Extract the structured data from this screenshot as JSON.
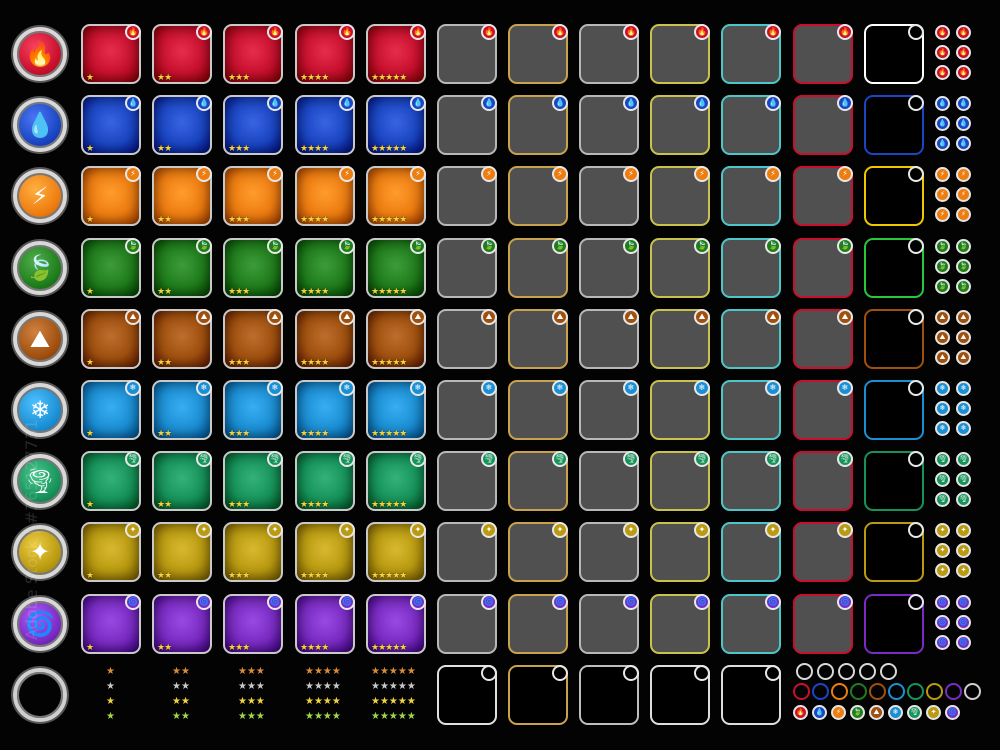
{
  "elements": [
    {
      "name": "fire",
      "icon": "fire-icon",
      "glyph": "🔥",
      "color": "#c8102e"
    },
    {
      "name": "water",
      "icon": "water-drop-icon",
      "glyph": "💧",
      "color": "#1a46c4"
    },
    {
      "name": "lightning",
      "icon": "lightning-icon",
      "glyph": "⚡",
      "color": "#ee7d10"
    },
    {
      "name": "nature",
      "icon": "leaf-icon",
      "glyph": "🍃",
      "color": "#1f7d1b"
    },
    {
      "name": "earth",
      "icon": "rock-icon",
      "glyph": "⛰",
      "color": "#a0500e"
    },
    {
      "name": "ice",
      "icon": "ice-crystal-icon",
      "glyph": "❄",
      "color": "#1b8fd4"
    },
    {
      "name": "wind",
      "icon": "tornado-icon",
      "glyph": "🌪",
      "color": "#16935a"
    },
    {
      "name": "light",
      "icon": "sparkle-icon",
      "glyph": "✦",
      "color": "#b99a10"
    },
    {
      "name": "dark",
      "icon": "vortex-icon",
      "glyph": "🌀",
      "color": "#7a2bc3"
    }
  ],
  "star_counts": [
    1,
    2,
    3,
    4,
    5
  ],
  "star_key_colors": [
    "#d98b3a",
    "#c8c8c8",
    "#f2d23a",
    "#9fd64a"
  ],
  "gray_border_colors": [
    "#b8b8b8",
    "#c9a34c",
    "#b8b8b8",
    "#c9c24c",
    "#4cc6c9",
    "#c8102e"
  ],
  "black_frame_colors": [
    "#ffffff",
    "#1a46c4",
    "#f0c800",
    "#28c83c",
    "#a0500e",
    "#1b8fd4",
    "#16935a",
    "#b99a10",
    "#7a2bc3"
  ],
  "ring_colors": [
    "#c8102e",
    "#1a46c4",
    "#ee7d10",
    "#1f7d1b",
    "#a0500e",
    "#1b8fd4",
    "#16935a",
    "#b99a10",
    "#7a2bc3",
    "#cfcfcf"
  ],
  "watermark": "Adobe Stock | #365127731"
}
